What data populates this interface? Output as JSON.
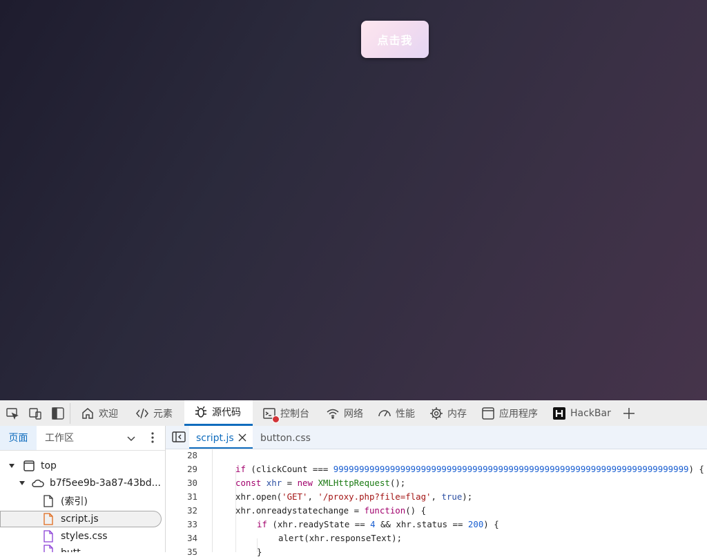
{
  "page": {
    "button_label": "点击我",
    "colors": {
      "bg_start": "#1e1c2e",
      "bg_end": "#46344b",
      "button_pink": "#fde7ef"
    }
  },
  "devtools": {
    "tools": [
      {
        "label": "欢迎",
        "icon": "home-icon"
      },
      {
        "label": "元素",
        "icon": "code-brackets-icon"
      },
      {
        "label": "源代码",
        "icon": "bug-icon",
        "active": true
      },
      {
        "label": "控制台",
        "icon": "console-icon",
        "badge": "error"
      },
      {
        "label": "网络",
        "icon": "wifi-icon"
      },
      {
        "label": "性能",
        "icon": "gauge-icon"
      },
      {
        "label": "内存",
        "icon": "chip-icon"
      },
      {
        "label": "应用程序",
        "icon": "window-icon"
      },
      {
        "label": "HackBar",
        "icon": "hackbar-h-icon"
      }
    ],
    "nav_tabs": {
      "page": "页面",
      "workspace": "工作区"
    },
    "tree": {
      "top": "top",
      "origin": "b7f5ee9b-3a87-43bd...",
      "files": [
        "(索引)",
        "script.js",
        "styles.css",
        "butt"
      ]
    },
    "editor_tabs": {
      "active": "script.js",
      "other": "button.css"
    },
    "code": {
      "line_numbers": [
        "28",
        "29",
        "30",
        "31",
        "32",
        "33",
        "34",
        "35"
      ],
      "lines": [
        "",
        "if (clickCount === 999999999999999999999999999999999999999999999999999999999999999999999) {",
        "const xhr = new XMLHttpRequest();",
        "xhr.open('GET', '/proxy.php?file=flag', true);",
        "xhr.onreadystatechange = function() {",
        "if (xhr.readyState == 4 && xhr.status == 200) {",
        "alert(xhr.responseText);",
        "}"
      ],
      "tokens": {
        "if_kw": "if",
        "click_var": "(clickCount ===",
        "big_num": "999999999999999999999999999999999999999999999999999999999999999999999",
        "close_brace": ") {",
        "const_kw": "const",
        "xhr_var": "xhr",
        "eq": "=",
        "new_kw": "new",
        "xhr_class": "XMLHttpRequest",
        "call_end": "();",
        "open_call": "xhr.open(",
        "get_str": "'GET'",
        "comma": ",",
        "url_str": "'/proxy.php?file=flag'",
        "true_kw": "true",
        "paren_semi": ");",
        "onready": "xhr.onreadystatechange =",
        "function_kw": "function",
        "fn_sig": "() {",
        "cond_a": "(xhr.readyState ==",
        "four": "4",
        "and_status": "&& xhr.status ==",
        "two_hundred": "200",
        "alert_call": "alert(xhr.responseText);",
        "brace": "}"
      }
    }
  }
}
